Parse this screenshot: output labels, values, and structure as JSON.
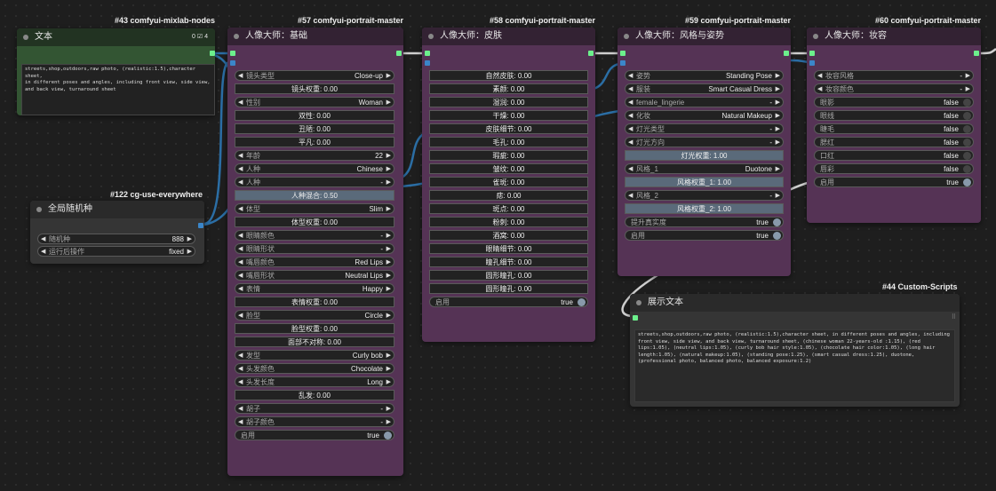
{
  "tags": {
    "n43": "#43 comfyui-mixlab-nodes",
    "n57": "#57 comfyui-portrait-master",
    "n58": "#58 comfyui-portrait-master",
    "n59": "#59 comfyui-portrait-master",
    "n60": "#60 comfyui-portrait-master",
    "n122": "#122 cg-use-everywhere",
    "n44": "#44 Custom-Scripts"
  },
  "n43": {
    "title": "文本",
    "hdr_icons": "0 ☑ 4",
    "text": "streets,shop,outdoors,raw photo, (realistic:1.5),character sheet,\nin different poses and angles, including front view, side view,\nand back view, turnaround sheet"
  },
  "n122": {
    "title": "全局随机种",
    "seed_label": "随机种",
    "seed_value": "888",
    "after_label": "运行后操作",
    "after_value": "fixed"
  },
  "n57": {
    "title": "人像大师：基础",
    "rows": [
      {
        "t": "combo",
        "label": "镜头类型",
        "value": "Close-up"
      },
      {
        "t": "slider",
        "text": "镜头权重: 0.00"
      },
      {
        "t": "combo",
        "label": "性别",
        "value": "Woman"
      },
      {
        "t": "slider",
        "text": "双性: 0.00"
      },
      {
        "t": "slider",
        "text": "丑陋: 0.00"
      },
      {
        "t": "slider",
        "text": "平凡: 0.00"
      },
      {
        "t": "combo",
        "label": "年龄",
        "value": "22"
      },
      {
        "t": "combo",
        "label": "人种",
        "value": "Chinese"
      },
      {
        "t": "combo",
        "label": "人种",
        "value": "-"
      },
      {
        "t": "sliderfill",
        "text": "人种混合: 0.50"
      },
      {
        "t": "combo",
        "label": "体型",
        "value": "Slim"
      },
      {
        "t": "slider",
        "text": "体型权重: 0.00"
      },
      {
        "t": "combo",
        "label": "眼睛颜色",
        "value": "-"
      },
      {
        "t": "combo",
        "label": "眼睛形状",
        "value": "-"
      },
      {
        "t": "combo",
        "label": "嘴唇颜色",
        "value": "Red Lips"
      },
      {
        "t": "combo",
        "label": "嘴唇形状",
        "value": "Neutral Lips"
      },
      {
        "t": "combo",
        "label": "表情",
        "value": "Happy"
      },
      {
        "t": "slider",
        "text": "表情权重: 0.00"
      },
      {
        "t": "combo",
        "label": "脸型",
        "value": "Circle"
      },
      {
        "t": "slider",
        "text": "脸型权重: 0.00"
      },
      {
        "t": "slider",
        "text": "面部不对称: 0.00"
      },
      {
        "t": "combo",
        "label": "发型",
        "value": "Curly bob"
      },
      {
        "t": "combo",
        "label": "头发颜色",
        "value": "Chocolate"
      },
      {
        "t": "combo",
        "label": "头发长度",
        "value": "Long"
      },
      {
        "t": "slider",
        "text": "乱发: 0.00"
      },
      {
        "t": "combo",
        "label": "胡子",
        "value": "-"
      },
      {
        "t": "combo",
        "label": "胡子颜色",
        "value": "-"
      },
      {
        "t": "toggle",
        "label": "启用",
        "value": "true",
        "on": true
      }
    ]
  },
  "n58": {
    "title": "人像大师：皮肤",
    "rows": [
      {
        "t": "slider",
        "text": "自然皮肤: 0.00"
      },
      {
        "t": "slider",
        "text": "素颜: 0.00"
      },
      {
        "t": "slider",
        "text": "湿润: 0.00"
      },
      {
        "t": "slider",
        "text": "干燥: 0.00"
      },
      {
        "t": "slider",
        "text": "皮肤细节: 0.00"
      },
      {
        "t": "slider",
        "text": "毛孔: 0.00"
      },
      {
        "t": "slider",
        "text": "瑕疵: 0.00"
      },
      {
        "t": "slider",
        "text": "皱纹: 0.00"
      },
      {
        "t": "slider",
        "text": "雀斑: 0.00"
      },
      {
        "t": "slider",
        "text": "痣: 0.00"
      },
      {
        "t": "slider",
        "text": "斑点: 0.00"
      },
      {
        "t": "slider",
        "text": "粉刺: 0.00"
      },
      {
        "t": "slider",
        "text": "酒窝: 0.00"
      },
      {
        "t": "slider",
        "text": "眼睛细节: 0.00"
      },
      {
        "t": "slider",
        "text": "瞳孔细节: 0.00"
      },
      {
        "t": "slider",
        "text": "圆形瞳孔: 0.00"
      },
      {
        "t": "slider",
        "text": "圆形瞳孔: 0.00"
      },
      {
        "t": "toggle",
        "label": "启用",
        "value": "true",
        "on": true
      }
    ]
  },
  "n59": {
    "title": "人像大师：风格与姿势",
    "rows": [
      {
        "t": "combo",
        "label": "姿势",
        "value": "Standing Pose"
      },
      {
        "t": "combo",
        "label": "服装",
        "value": "Smart Casual Dress"
      },
      {
        "t": "combo",
        "label": "female_lingerie",
        "value": "-"
      },
      {
        "t": "combo",
        "label": "化妆",
        "value": "Natural Makeup"
      },
      {
        "t": "combo",
        "label": "灯光类型",
        "value": "-"
      },
      {
        "t": "combo",
        "label": "灯光方向",
        "value": "-"
      },
      {
        "t": "sliderfill",
        "text": "灯光权重: 1.00"
      },
      {
        "t": "combo",
        "label": "风格_1",
        "value": "Duotone"
      },
      {
        "t": "sliderfill",
        "text": "风格权重_1: 1.00"
      },
      {
        "t": "combo",
        "label": "风格_2",
        "value": "-"
      },
      {
        "t": "sliderfill",
        "text": "风格权重_2: 1.00"
      },
      {
        "t": "toggle",
        "label": "提升真实度",
        "value": "true",
        "on": true
      },
      {
        "t": "toggle",
        "label": "启用",
        "value": "true",
        "on": true
      }
    ]
  },
  "n60": {
    "title": "人像大师：妆容",
    "rows": [
      {
        "t": "combo",
        "label": "妆容风格",
        "value": "-"
      },
      {
        "t": "combo",
        "label": "妆容颜色",
        "value": "-"
      },
      {
        "t": "toggle",
        "label": "眼影",
        "value": "false",
        "on": false
      },
      {
        "t": "toggle",
        "label": "眼线",
        "value": "false",
        "on": false
      },
      {
        "t": "toggle",
        "label": "睫毛",
        "value": "false",
        "on": false
      },
      {
        "t": "toggle",
        "label": "腮红",
        "value": "false",
        "on": false
      },
      {
        "t": "toggle",
        "label": "口红",
        "value": "false",
        "on": false
      },
      {
        "t": "toggle",
        "label": "唇彩",
        "value": "false",
        "on": false
      },
      {
        "t": "toggle",
        "label": "启用",
        "value": "true",
        "on": true
      }
    ]
  },
  "n44": {
    "title": "展示文本",
    "text": "streets,shop,outdoors,raw photo, (realistic:1.5),character sheet, in different poses and angles, including front view, side view, and back view, turnaround sheet, (chinese woman 22-years-old :1.15), (red lips:1.05), (neutral lips:1.05), (curly bob hair style:1.05), (chocolate hair color:1.05), (long hair length:1.05), (natural makeup:1.05), (standing pose:1.25), (smart casual dress:1.25), duotone, (professional photo, balanced photo, balanced exposure:1.2)"
  },
  "colors": {
    "canvas": "#1e1e1e",
    "purple_node": "#553355",
    "green_node": "#335533",
    "gray_node": "#353535",
    "wire_blue": "#2b6ea5",
    "wire_gray": "#cfcfcf",
    "output_slot": "#6cf08c"
  }
}
